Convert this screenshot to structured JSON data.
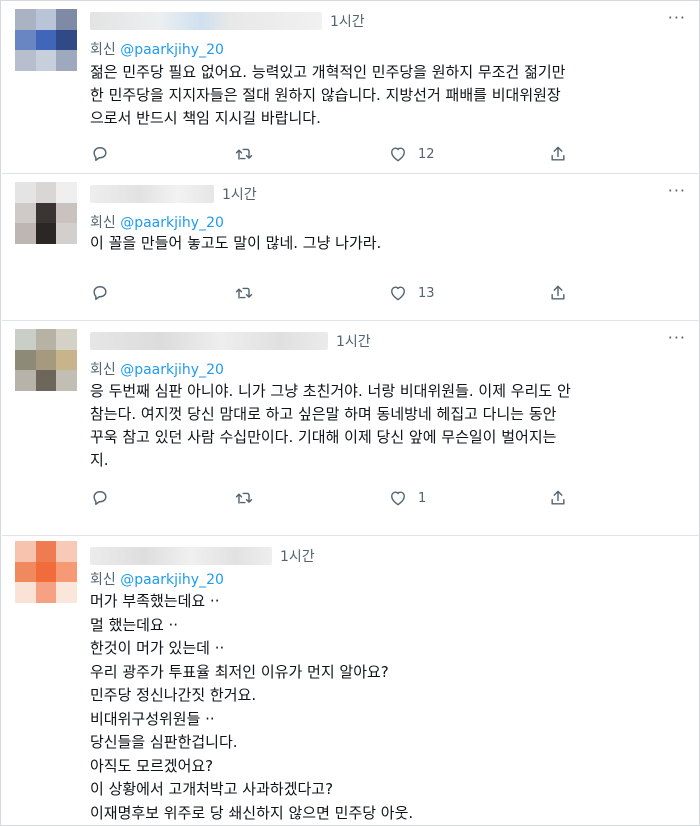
{
  "tweets": [
    {
      "time": "1시간",
      "reply_prefix": "회신",
      "reply_handle": "@paarkjihy_20",
      "lines": [
        "젊은 민주당 필요 없어요. 능력있고 개혁적인 민주당을 원하지 무조건 젊기만",
        "한 민주당을 지지자들은 절대 원하지 않습니다. 지방선거 패배를 비대위원장",
        "으로서 반드시 책임 지시길 바랍니다."
      ],
      "like_count": "12",
      "avatar_colors": [
        "#aab3c4",
        "#b9c4d8",
        "#7e8aa6",
        "#6a86c2",
        "#3f66b8",
        "#2f4a86",
        "#b7bfcf",
        "#c8cfdc",
        "#9fa9bd"
      ]
    },
    {
      "time": "1시간",
      "reply_prefix": "회신",
      "reply_handle": "@paarkjihy_20",
      "lines": [
        "이 꼴을 만들어 놓고도 말이 많네. 그냥 나가라."
      ],
      "like_count": "13",
      "avatar_colors": [
        "#e4e4e4",
        "#d9d6d4",
        "#efefef",
        "#cfcac7",
        "#3a3533",
        "#c9c2bf",
        "#bdb6b3",
        "#2b2725",
        "#d3cfcd"
      ]
    },
    {
      "time": "1시간",
      "reply_prefix": "회신",
      "reply_handle": "@paarkjihy_20",
      "lines": [
        "응 두번째 심판 아니야. 니가 그냥 초친거야. 너랑 비대위원들. 이제 우리도 안",
        "참는다. 여지껏 당신 맘대로 하고 싶은말 하며 동네방네 헤집고 다니는 동안",
        "꾸욱 참고 있던 사람 수십만이다. 기대해 이제 당신 앞에 무슨일이 벌어지는",
        "지."
      ],
      "like_count": "1",
      "avatar_colors": [
        "#c9cfc7",
        "#b6b3a4",
        "#d4d2c6",
        "#8e8a78",
        "#a59a7e",
        "#c7b48a",
        "#b8b3a8",
        "#6e665a",
        "#c2beb3"
      ]
    },
    {
      "time": "1시간",
      "reply_prefix": "회신",
      "reply_handle": "@paarkjihy_20",
      "lines": [
        "머가 부족했는데요 ··",
        "멀 했는데요 ··",
        "한것이 머가 있는데 ··",
        "우리 광주가 투표율 최저인 이유가 먼지 알아요?",
        "민주당 정신나간짓 한거요.",
        "비대위구성위원들 ··",
        "당신들을 심판한겁니다.",
        "아직도 모르겠어요?",
        "이 상황에서 고개처박고 사과하겠다고?",
        "이재명후보 위주로 당 쇄신하지 않으면 민주당 아웃."
      ],
      "like_count": "",
      "avatar_colors": [
        "#f7c3ae",
        "#ee7b52",
        "#f7c9b6",
        "#f08a5e",
        "#f26b3a",
        "#f59a74",
        "#fbe2d6",
        "#f6a181",
        "#fbe6dc"
      ]
    }
  ],
  "colors": {
    "handle": "#1d9bf0",
    "secondary_text": "#536471",
    "divider": "#e1e4e6"
  },
  "icons": [
    "reply-icon",
    "retweet-icon",
    "like-icon",
    "share-icon",
    "more-icon"
  ]
}
